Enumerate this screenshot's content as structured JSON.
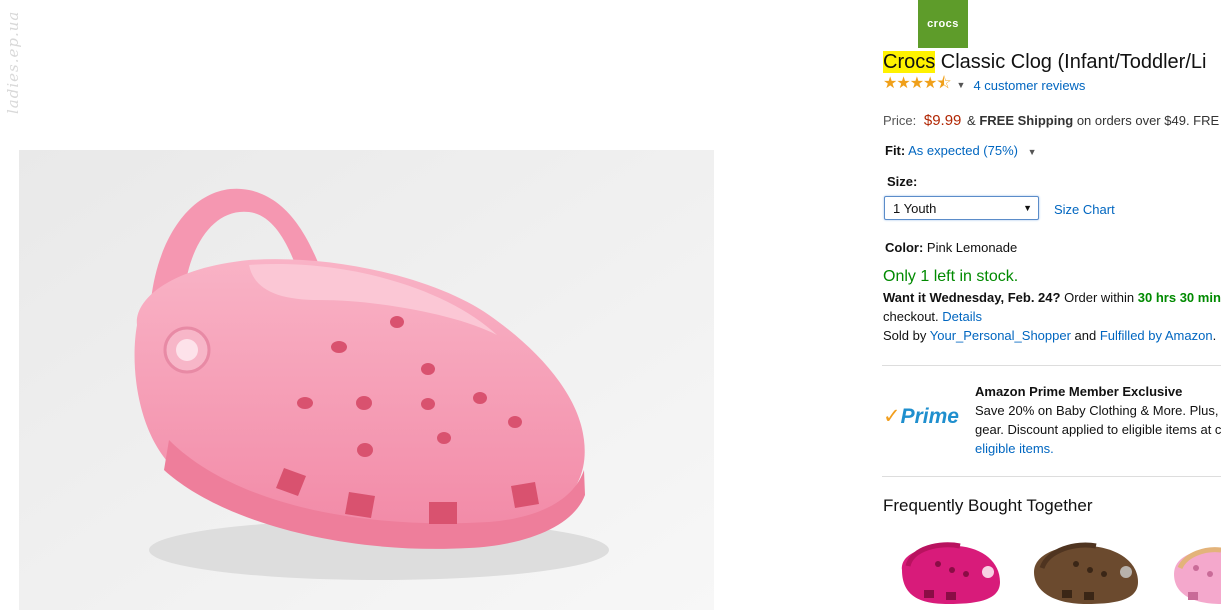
{
  "watermark": "ladies.ep.ua",
  "brand_logo": "crocs",
  "title": {
    "brand": "Crocs",
    "rest": " Classic Clog (Infant/Toddler/Li"
  },
  "rating": {
    "stars": 4.5,
    "reviews": "4 customer reviews"
  },
  "price": {
    "label": "Price:",
    "value": "$9.99",
    "amp": " & ",
    "free_shipping": "FREE Shipping",
    "suffix": " on orders over $49. FRE"
  },
  "fit": {
    "label": "Fit:",
    "value": "As expected (75%)"
  },
  "size": {
    "label": "Size:",
    "selected": "1 Youth",
    "chart_link": "Size Chart"
  },
  "color": {
    "label": "Color:",
    "value": "Pink Lemonade"
  },
  "stock": "Only 1 left in stock.",
  "delivery": {
    "want": "Want it Wednesday, Feb. 24?",
    "order_within": " Order within ",
    "time": "30 hrs 30 min",
    "checkout": "checkout.",
    "details": "Details"
  },
  "sold": {
    "prefix": "Sold by ",
    "seller": "Your_Personal_Shopper",
    "and": " and ",
    "fulfilled": "Fulfilled by Amazon",
    "end": "."
  },
  "prime": {
    "logo_check": "✓",
    "logo_text": "Prime",
    "title": "Amazon Prime Member Exclusive",
    "line1": "Save 20% on Baby Clothing & More. Plus,",
    "line2": "gear. Discount applied to eligible items at c",
    "link": "eligible items."
  },
  "fbt_title": "Frequently Bought Together",
  "colors": {
    "shoe_pink": "#f7a1b6",
    "thumb_magenta": "#d81b7a",
    "thumb_brown": "#6b4a2e",
    "thumb_light_pink": "#f4a8cc",
    "price": "#b12704",
    "link": "#0066c0",
    "stock": "#008a00"
  },
  "icons": [
    "star-icon",
    "caret-down-icon",
    "prime-logo",
    "crocs-logo"
  ]
}
